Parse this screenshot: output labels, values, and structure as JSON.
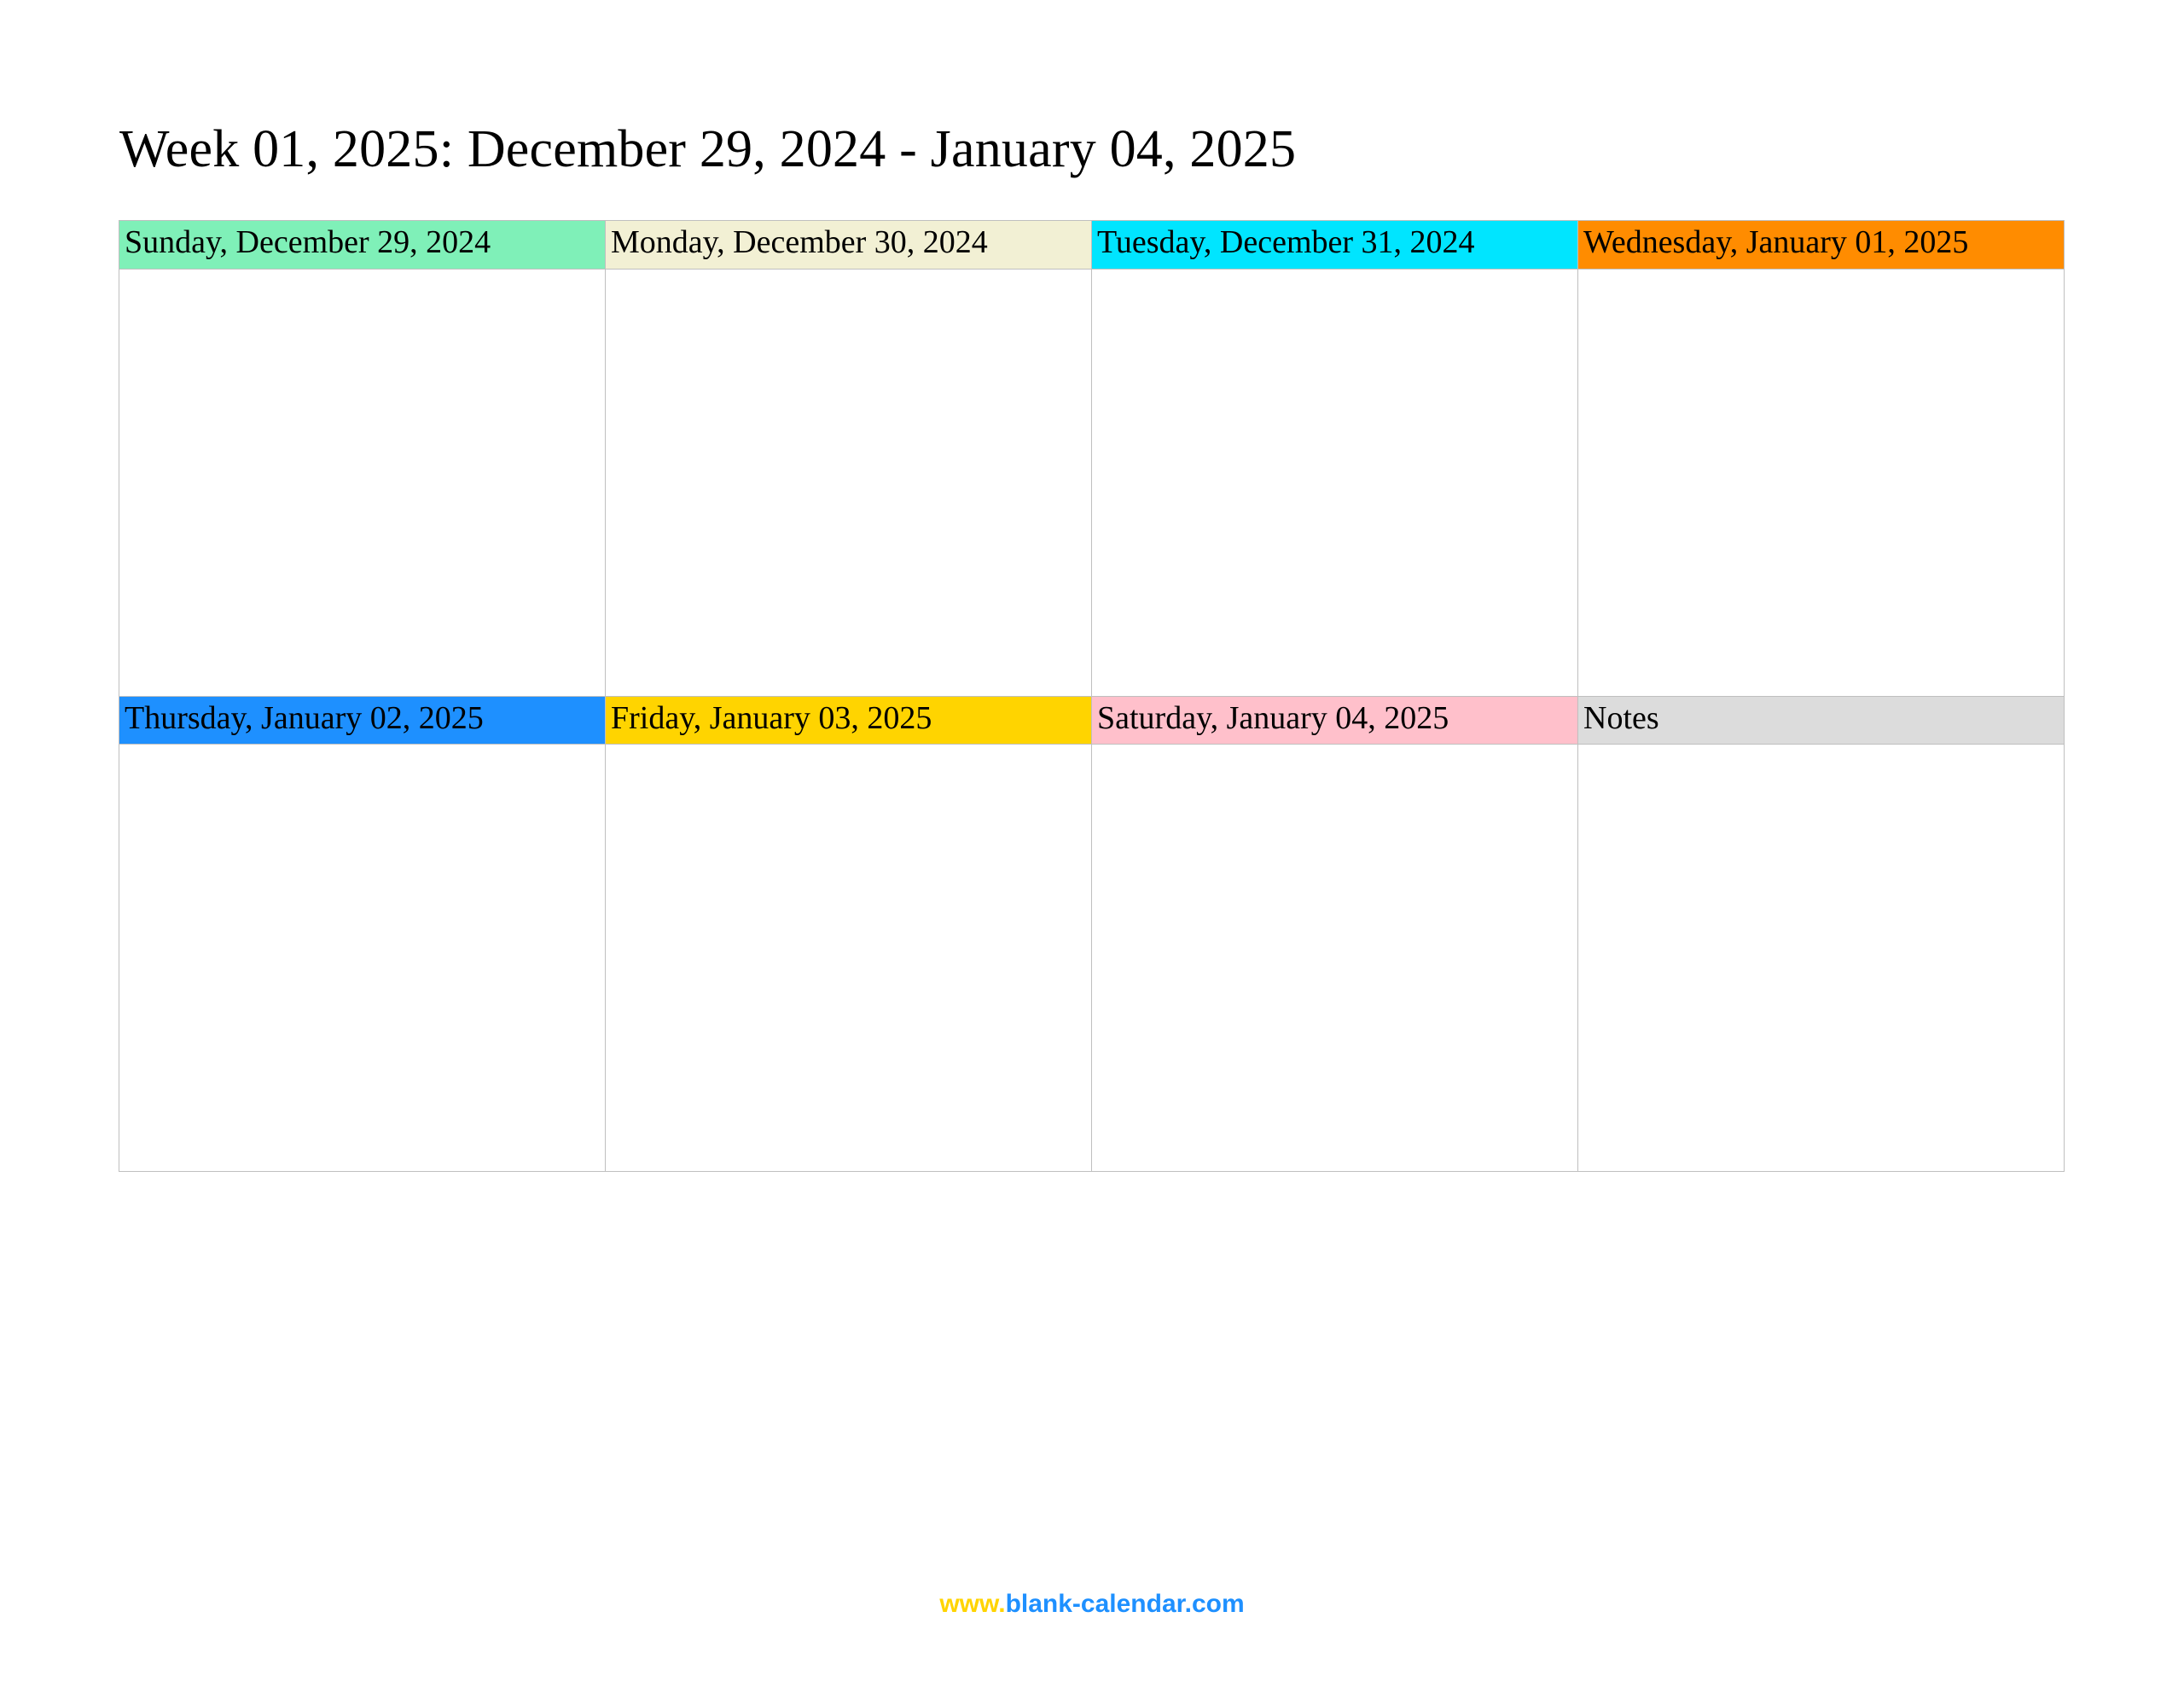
{
  "title": "Week 01, 2025: December 29, 2024 - January 04, 2025",
  "cells": [
    {
      "label": "Sunday, December 29, 2024",
      "colorClass": "c-sun"
    },
    {
      "label": "Monday, December 30, 2024",
      "colorClass": "c-mon"
    },
    {
      "label": "Tuesday, December 31, 2024",
      "colorClass": "c-tue"
    },
    {
      "label": "Wednesday, January 01, 2025",
      "colorClass": "c-wed"
    },
    {
      "label": "Thursday, January 02, 2025",
      "colorClass": "c-thu"
    },
    {
      "label": "Friday, January 03, 2025",
      "colorClass": "c-fri"
    },
    {
      "label": "Saturday, January 04, 2025",
      "colorClass": "c-sat"
    },
    {
      "label": "Notes",
      "colorClass": "c-notes"
    }
  ],
  "footer": {
    "part1": "www.",
    "part2": "blank-calendar.com"
  }
}
